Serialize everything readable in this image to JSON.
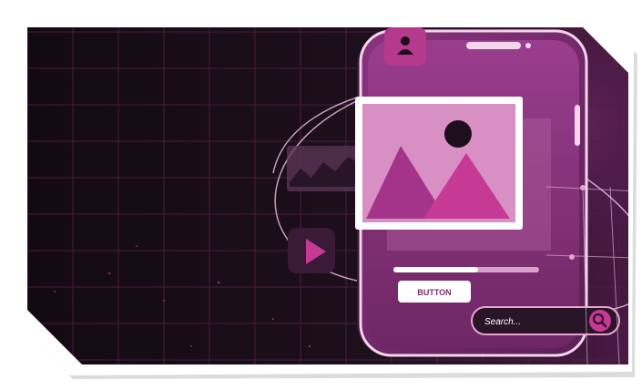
{
  "illustration": {
    "button_label": "BUTTON",
    "search_placeholder": "Search...",
    "progress_fraction": 0.58,
    "colors": {
      "background": "#170d16",
      "grid": "#5a2350",
      "phone_body": "#7a2a6e",
      "phone_screen": "#8d3681",
      "accent_pink": "#c63a95",
      "light_pink": "#e6a3cf",
      "frame_white": "#ffffff"
    },
    "icons": [
      "user-icon",
      "image-icon",
      "play-icon",
      "chart-icon",
      "search-icon"
    ]
  }
}
